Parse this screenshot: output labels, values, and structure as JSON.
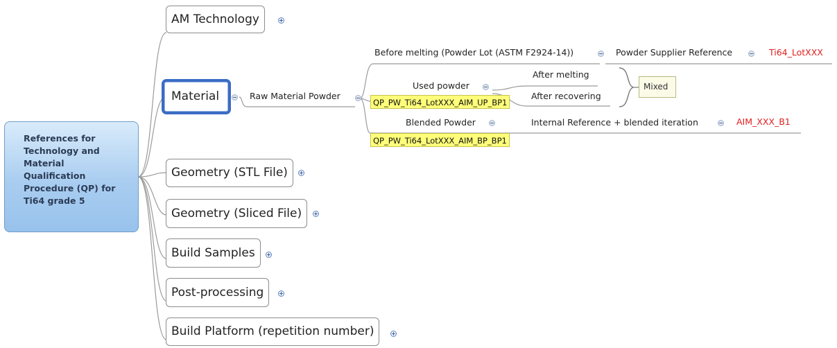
{
  "root": {
    "lines": [
      "References for",
      "Technology and",
      "Material",
      "Qualification",
      "Procedure (QP) for",
      "Ti64 grade 5"
    ]
  },
  "topics": [
    {
      "label": "AM Technology",
      "expand_icon": "plus-icon"
    },
    {
      "label": "Material",
      "expand_icon": "minus-icon",
      "selected": true
    },
    {
      "label": "Geometry (STL File)",
      "expand_icon": "plus-icon"
    },
    {
      "label": "Geometry (Sliced File)",
      "expand_icon": "plus-icon"
    },
    {
      "label": "Build Samples",
      "expand_icon": "plus-icon"
    },
    {
      "label": "Post-processing",
      "expand_icon": "plus-icon"
    },
    {
      "label": "Build Platform (repetition number)",
      "expand_icon": "plus-icon"
    }
  ],
  "material": {
    "raw_powder": "Raw Material Powder",
    "before_melting": "Before melting (Powder Lot (ASTM F2924-14))",
    "powder_supplier": "Powder Supplier Reference",
    "supplier_lot": "Ti64_LotXXX",
    "used_powder": "Used powder",
    "used_powder_tag": "QP_PW_Ti64_LotXXX_AIM_UP_BP1",
    "after_melting": "After melting",
    "after_recovering": "After recovering",
    "mixed": "Mixed",
    "blended_powder": "Blended Powder",
    "blended_tag": "QP_PW_Ti64_LotXXX_AIM_BP_BP1",
    "internal_reference": "Internal Reference + blended iteration",
    "blend_code": "AIM_XXX_B1"
  },
  "colors": {
    "connector": "#9a9a9a",
    "selected_border": "#3b6cc4",
    "code_text": "#e21d1d",
    "tag_fill": "#ffff7a",
    "root_fill": "#a9cdf0"
  }
}
